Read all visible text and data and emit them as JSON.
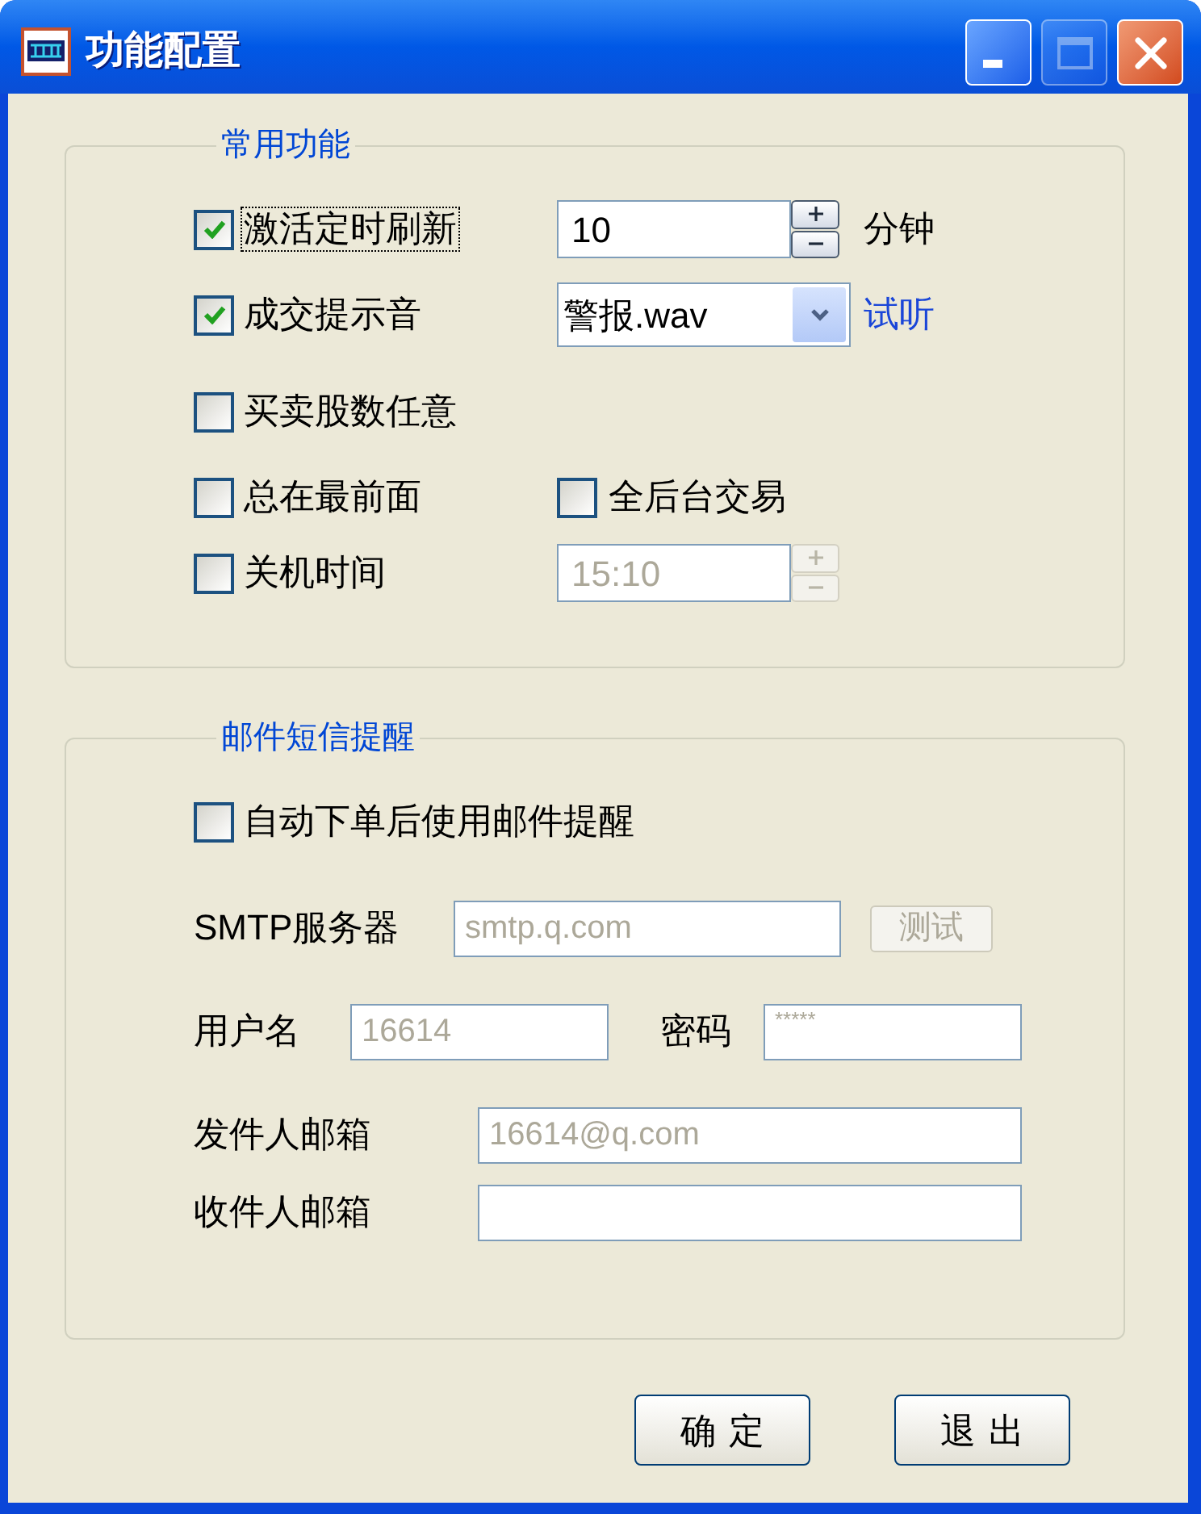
{
  "window": {
    "title": "功能配置",
    "maximize_disabled": true
  },
  "common": {
    "title": "常用功能",
    "options": [
      {
        "kind": "spin",
        "label": "激活定时刷新",
        "checked": true,
        "focused": true,
        "value": "10",
        "unit": "分钟",
        "disabled": false
      },
      {
        "kind": "select",
        "label": "成交提示音",
        "checked": true,
        "focused": false,
        "value": "警报.wav",
        "link": "试听"
      },
      {
        "kind": "plain",
        "label": "买卖股数任意",
        "checked": false,
        "focused": false
      },
      {
        "kind": "pair",
        "label": "总在最前面",
        "checked": false,
        "focused": false,
        "second": {
          "label": "全后台交易",
          "checked": false
        }
      },
      {
        "kind": "spin",
        "label": "关机时间",
        "checked": false,
        "focused": false,
        "value": "15:10",
        "disabled": true
      }
    ]
  },
  "email": {
    "title": "邮件短信提醒",
    "enable": {
      "label": "自动下单后使用邮件提醒",
      "checked": false
    },
    "fields": [
      {
        "kind": "server",
        "label": "SMTP服务器",
        "value": "smtp.q.com",
        "disabled": true,
        "button": {
          "label": "测试",
          "disabled": true
        }
      },
      {
        "kind": "pair",
        "label": "用户名",
        "value": "16614",
        "disabled": true,
        "second": {
          "label": "密码",
          "value": "*****",
          "disabled": true
        }
      },
      {
        "kind": "wide",
        "label": "发件人邮箱",
        "value": "16614@q.com",
        "disabled": true
      },
      {
        "kind": "wide",
        "label": "收件人邮箱"
      }
    ]
  },
  "buttons": [
    "确定",
    "退出"
  ]
}
